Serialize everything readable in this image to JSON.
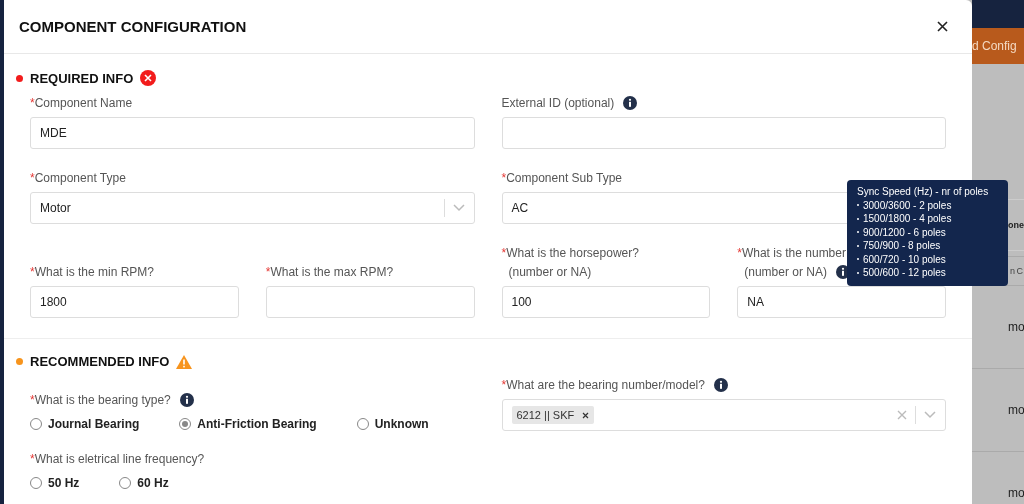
{
  "background": {
    "button": "d Config",
    "column_header": "one",
    "search_placeholder": "n C",
    "rows": [
      "mo",
      "mo",
      "mo"
    ]
  },
  "modal": {
    "title": "COMPONENT CONFIGURATION",
    "sections": [
      {
        "title": "REQUIRED INFO",
        "kind": "error",
        "rows": [
          [
            {
              "kind": "text",
              "required_mark": "*",
              "info": false,
              "label": "Component Name",
              "value": "MDE"
            },
            {
              "kind": "text",
              "info": true,
              "label": "External ID (optional)"
            }
          ],
          [
            {
              "kind": "select",
              "required_mark": "*",
              "info": false,
              "label": "Component Type",
              "value": "Motor"
            },
            {
              "kind": "select",
              "required_mark": "*",
              "info": false,
              "label": "Component Sub Type",
              "value": "AC"
            }
          ],
          [
            {
              "kind": "text",
              "required_mark": "*",
              "info": false,
              "label": "What is the min RPM?",
              "value": "1800"
            },
            {
              "kind": "text",
              "required_mark": "*",
              "info": false,
              "label": "What is the max RPM?"
            },
            {
              "kind": "text",
              "required_mark": "*",
              "info": false,
              "label": "What is the horsepower?",
              "hint": "(number or NA)",
              "value": "100"
            },
            {
              "kind": "text",
              "required_mark": "*",
              "info": true,
              "label": "What is the number",
              "hint": "(number or NA)",
              "value": "NA"
            }
          ]
        ]
      },
      {
        "title": "RECOMMENDED INFO",
        "kind": "warning",
        "rows": [
          [
            {
              "kind": "radio",
              "required_mark": "*",
              "info": true,
              "label": "What is the bearing type?",
              "options": [
                {
                  "label": "Journal Bearing",
                  "selected": false
                },
                {
                  "label": "Anti-Friction Bearing",
                  "selected": true
                },
                {
                  "label": "Unknown",
                  "selected": false
                }
              ]
            },
            {
              "kind": "multiselect",
              "required_mark": "*",
              "info": true,
              "label": "What are the bearing number/model?",
              "tags": [
                "6212 || SKF"
              ]
            }
          ],
          [
            {
              "kind": "radio",
              "required_mark": "*",
              "info": false,
              "label": "What is eletrical line frequency?",
              "options": [
                {
                  "label": "50 Hz",
                  "selected": false
                },
                {
                  "label": "60 Hz",
                  "selected": false
                }
              ]
            }
          ]
        ]
      }
    ]
  },
  "tooltip": {
    "title": "Sync Speed (Hz) - nr of poles",
    "items": [
      "3000/3600 - 2 poles",
      "1500/1800 - 4 poles",
      "900/1200 - 6 poles",
      "750/900 - 8 poles",
      "600/720 - 10 poles",
      "500/600 - 12 poles"
    ]
  }
}
